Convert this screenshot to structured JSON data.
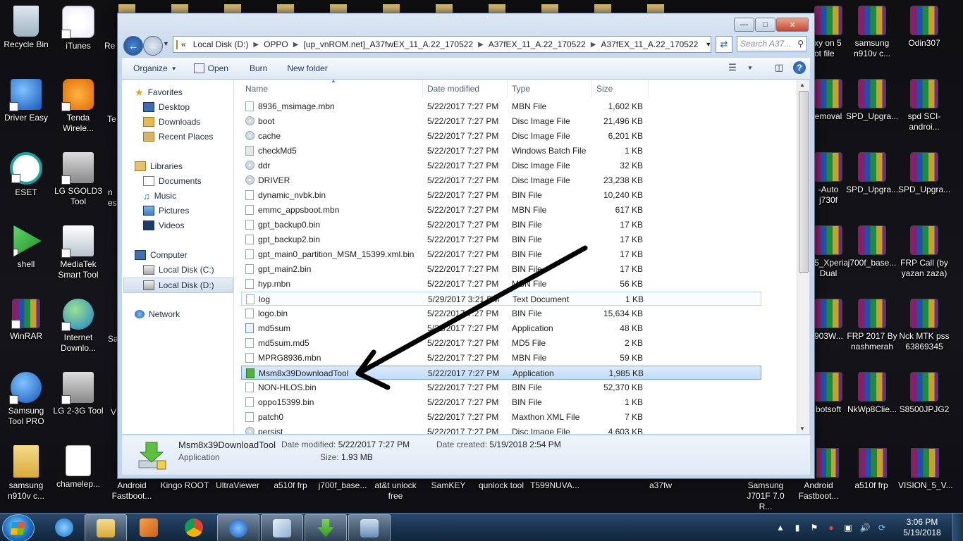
{
  "desktop": {
    "icons_left": [
      {
        "label": "Recycle Bin",
        "icon": "recycle-bin-icon"
      },
      {
        "label": "iTunes",
        "icon": "itunes-icon"
      },
      {
        "label": "Driver Easy",
        "icon": "driver-easy-icon"
      },
      {
        "label": "Tenda Wirele...",
        "icon": "tenda-icon"
      },
      {
        "label": "ESET",
        "icon": "eset-icon"
      },
      {
        "label": "LG SGOLD3 Tool",
        "icon": "lg-tool-icon"
      },
      {
        "label": "shell",
        "icon": "shell-icon"
      },
      {
        "label": "MediaTek Smart Tool",
        "icon": "mediatek-icon"
      },
      {
        "label": "WinRAR",
        "icon": "winrar-icon"
      },
      {
        "label": "Internet Downlo...",
        "icon": "idm-icon"
      },
      {
        "label": "Samsung Tool PRO",
        "icon": "samsung-tool-icon"
      },
      {
        "label": "LG 2-3G Tool",
        "icon": "lg-tool-icon"
      },
      {
        "label": "samsung n910v c...",
        "icon": "winrar-archive-icon"
      },
      {
        "label": "chameleр...",
        "icon": "file-icon"
      }
    ],
    "partial_left": [
      "Re",
      "Te",
      "n es",
      "Sa",
      "V"
    ],
    "bottom_row": [
      "Android Fastboot...",
      "Kingo ROOT",
      "UltraViewer",
      "a510f frp",
      "j700f_base...",
      "at&t unlock free",
      "SamKEY",
      "qunlock tool",
      "T599NUVA...",
      "a37fw",
      "Samsung J701F 7.0 R...",
      "Android Fastboot...",
      "a510f frp",
      "VISION_5_V..."
    ],
    "partial_right": [
      "xy on 5 ot file",
      "emoval",
      "-Auto j730f",
      "5_Xperia Dual",
      "903W...",
      "botsoft"
    ],
    "icons_right": [
      {
        "label": "samsung n910v c..."
      },
      {
        "label": "Odin307"
      },
      {
        "label": "SPD_Upgra..."
      },
      {
        "label": "spd SCI-androi..."
      },
      {
        "label": "SPD_Upgra..."
      },
      {
        "label": "SPD_Upgra..."
      },
      {
        "label": "j700f_base..."
      },
      {
        "label": "FRP Call (by yazan zaza)"
      },
      {
        "label": "FRP 2017 By nashmerah"
      },
      {
        "label": "Nck MTK pss 63869345"
      },
      {
        "label": "NkWp8Clie..."
      },
      {
        "label": "S8500JPJG2"
      }
    ]
  },
  "explorer": {
    "address": {
      "overflow": "«",
      "crumbs": [
        "Local Disk (D:)",
        "OPPO",
        "[up_vnROM.net]_A37fwEX_11_A.22_170522",
        "A37fEX_11_A.22_170522",
        "A37fEX_11_A.22_170522"
      ]
    },
    "search_placeholder": "Search A37...",
    "toolbar": {
      "organize": "Organize",
      "open": "Open",
      "burn": "Burn",
      "new_folder": "New folder"
    },
    "nav": {
      "favorites": "Favorites",
      "desktop": "Desktop",
      "downloads": "Downloads",
      "recent": "Recent Places",
      "libraries": "Libraries",
      "documents": "Documents",
      "music": "Music",
      "pictures": "Pictures",
      "videos": "Videos",
      "computer": "Computer",
      "disk_c": "Local Disk (C:)",
      "disk_d": "Local Disk (D:)",
      "network": "Network"
    },
    "columns": {
      "name": "Name",
      "date": "Date modified",
      "type": "Type",
      "size": "Size"
    },
    "files": [
      {
        "name": "8936_msimage.mbn",
        "date": "5/22/2017 7:27 PM",
        "type": "MBN File",
        "size": "1,602 KB",
        "icon": "file-icon"
      },
      {
        "name": "boot",
        "date": "5/22/2017 7:27 PM",
        "type": "Disc Image File",
        "size": "21,496 KB",
        "icon": "disc-image-icon"
      },
      {
        "name": "cache",
        "date": "5/22/2017 7:27 PM",
        "type": "Disc Image File",
        "size": "6,201 KB",
        "icon": "disc-image-icon"
      },
      {
        "name": "checkMd5",
        "date": "5/22/2017 7:27 PM",
        "type": "Windows Batch File",
        "size": "1 KB",
        "icon": "batch-file-icon"
      },
      {
        "name": "ddr",
        "date": "5/22/2017 7:27 PM",
        "type": "Disc Image File",
        "size": "32 KB",
        "icon": "disc-image-icon"
      },
      {
        "name": "DRIVER",
        "date": "5/22/2017 7:27 PM",
        "type": "Disc Image File",
        "size": "23,238 KB",
        "icon": "disc-image-icon"
      },
      {
        "name": "dynamic_nvbk.bin",
        "date": "5/22/2017 7:27 PM",
        "type": "BIN File",
        "size": "10,240 KB",
        "icon": "file-icon"
      },
      {
        "name": "emmc_appsboot.mbn",
        "date": "5/22/2017 7:27 PM",
        "type": "MBN File",
        "size": "617 KB",
        "icon": "file-icon"
      },
      {
        "name": "gpt_backup0.bin",
        "date": "5/22/2017 7:27 PM",
        "type": "BIN File",
        "size": "17 KB",
        "icon": "file-icon"
      },
      {
        "name": "gpt_backup2.bin",
        "date": "5/22/2017 7:27 PM",
        "type": "BIN File",
        "size": "17 KB",
        "icon": "file-icon"
      },
      {
        "name": "gpt_main0_partition_MSM_15399.xml.bin",
        "date": "5/22/2017 7:27 PM",
        "type": "BIN File",
        "size": "17 KB",
        "icon": "file-icon"
      },
      {
        "name": "gpt_main2.bin",
        "date": "5/22/2017 7:27 PM",
        "type": "BIN File",
        "size": "17 KB",
        "icon": "file-icon"
      },
      {
        "name": "hyp.mbn",
        "date": "5/22/2017 7:27 PM",
        "type": "MBN File",
        "size": "56 KB",
        "icon": "file-icon"
      },
      {
        "name": "log",
        "date": "5/29/2017 3:21 PM",
        "type": "Text Document",
        "size": "1 KB",
        "icon": "text-file-icon"
      },
      {
        "name": "logo.bin",
        "date": "5/22/2017 7:27 PM",
        "type": "BIN File",
        "size": "15,634 KB",
        "icon": "file-icon"
      },
      {
        "name": "md5sum",
        "date": "5/22/2017 7:27 PM",
        "type": "Application",
        "size": "48 KB",
        "icon": "application-icon"
      },
      {
        "name": "md5sum.md5",
        "date": "5/22/2017 7:27 PM",
        "type": "MD5 File",
        "size": "2 KB",
        "icon": "file-icon"
      },
      {
        "name": "MPRG8936.mbn",
        "date": "5/22/2017 7:27 PM",
        "type": "MBN File",
        "size": "59 KB",
        "icon": "file-icon"
      },
      {
        "name": "Msm8x39DownloadTool",
        "date": "5/22/2017 7:27 PM",
        "type": "Application",
        "size": "1,985 KB",
        "icon": "download-tool-icon"
      },
      {
        "name": "NON-HLOS.bin",
        "date": "5/22/2017 7:27 PM",
        "type": "BIN File",
        "size": "52,370 KB",
        "icon": "file-icon"
      },
      {
        "name": "oppo15399.bin",
        "date": "5/22/2017 7:27 PM",
        "type": "BIN File",
        "size": "1 KB",
        "icon": "file-icon"
      },
      {
        "name": "patch0",
        "date": "5/22/2017 7:27 PM",
        "type": "Maxthon XML File",
        "size": "7 KB",
        "icon": "xml-file-icon"
      },
      {
        "name": "persist",
        "date": "5/22/2017 7:27 PM",
        "type": "Disc Image File",
        "size": "4,603 KB",
        "icon": "disc-image-icon"
      }
    ],
    "details": {
      "name": "Msm8x39DownloadTool",
      "kind": "Application",
      "modified_label": "Date modified:",
      "modified": "5/22/2017 7:27 PM",
      "created_label": "Date created:",
      "created": "5/19/2018 2:54 PM",
      "size_label": "Size:",
      "size": "1.93 MB"
    }
  },
  "taskbar": {
    "time": "3:06 PM",
    "date": "5/19/2018"
  }
}
